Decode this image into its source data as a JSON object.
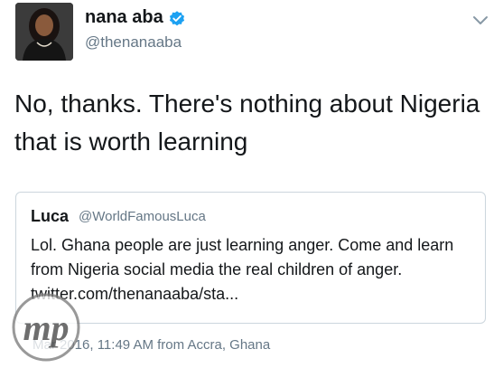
{
  "tweet": {
    "author": {
      "display_name": "nana aba",
      "handle": "@thenanaaba",
      "verified": true
    },
    "text": "No, thanks. There's nothing about Nigeria that is worth learning",
    "quoted": {
      "name": "Luca",
      "handle": "@WorldFamousLuca",
      "text": "Lol. Ghana people are just learning anger. Come and learn from Nigeria social media the real children of anger. twitter.com/thenanaaba/sta..."
    },
    "meta": {
      "date_time": "Mar 2016, 11:49 AM",
      "from_label": "from",
      "location": "Accra, Ghana"
    }
  },
  "icons": {
    "verified": "verified-badge-icon",
    "menu": "chevron-down-icon"
  },
  "colors": {
    "accent_blue": "#1da1f2",
    "secondary_text": "#657786",
    "border": "#ccd6dd"
  },
  "watermark": {
    "text": "mp"
  }
}
